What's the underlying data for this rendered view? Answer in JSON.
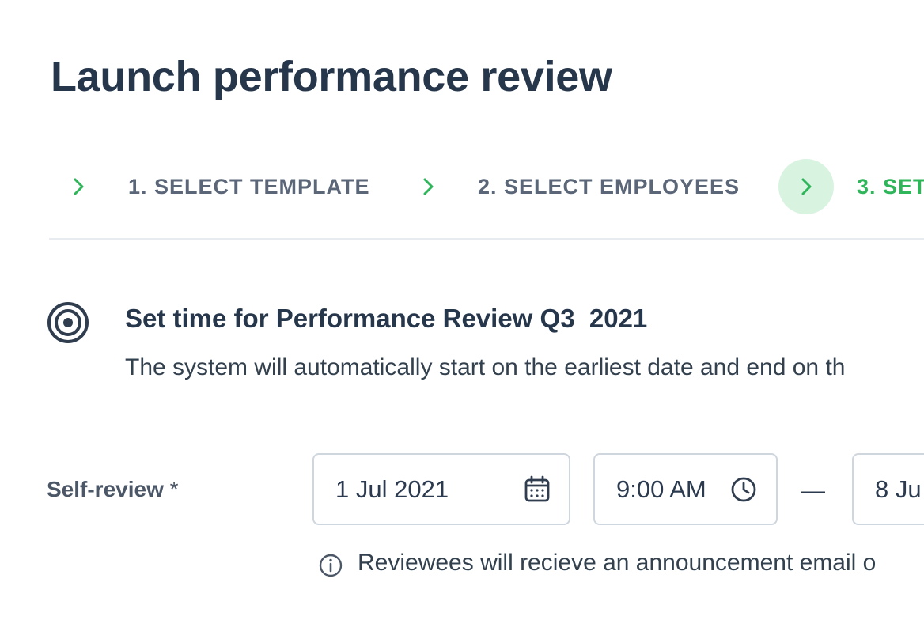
{
  "page": {
    "title": "Launch performance review"
  },
  "stepper": {
    "steps": [
      {
        "label": "1. SELECT TEMPLATE",
        "active": false
      },
      {
        "label": "2. SELECT EMPLOYEES",
        "active": false
      },
      {
        "label": "3. SET",
        "active": true
      }
    ],
    "icon": "chevron-right-icon"
  },
  "section": {
    "icon": "target-icon",
    "title": "Set time for Performance Review Q3  2021",
    "description": "The system will automatically start on the earliest date and end on th"
  },
  "self_review": {
    "label": "Self-review",
    "required_mark": "*",
    "start_date": "1 Jul 2021",
    "start_time": "9:00 AM",
    "separator": "—",
    "end_date": "8 Ju",
    "hint": "Reviewees will recieve an announcement email o"
  },
  "colors": {
    "accent_green": "#2fb55a",
    "active_step_bg": "#d9f3e1",
    "heading": "#26364b",
    "muted_text": "#5b6778",
    "border": "#cfd6de"
  }
}
